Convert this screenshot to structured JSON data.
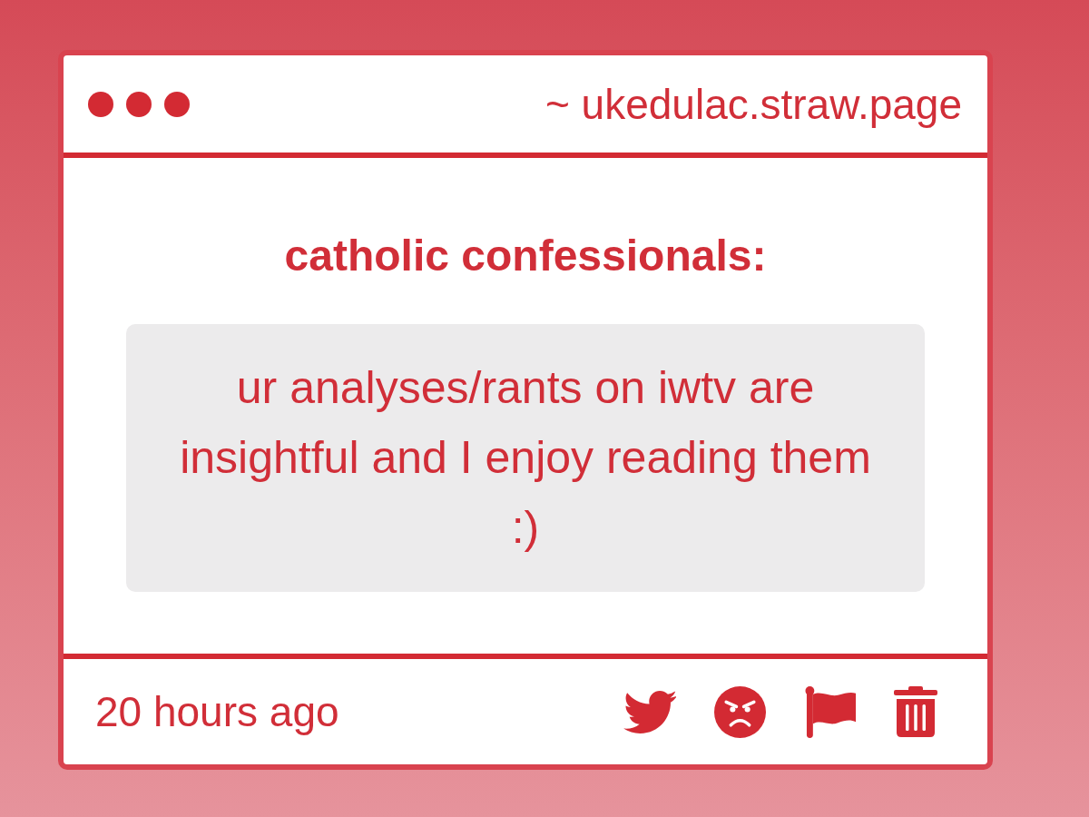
{
  "window": {
    "address": "~ ukedulac.straw.page"
  },
  "question": {
    "heading": "catholic confessionals:",
    "message": "ur analyses/rants on iwtv are insightful and I enjoy reading them :)"
  },
  "footer": {
    "time": "20 hours ago",
    "actions": [
      {
        "kind": "bird"
      },
      {
        "kind": "angry"
      },
      {
        "kind": "flag"
      },
      {
        "kind": "trash"
      }
    ]
  }
}
